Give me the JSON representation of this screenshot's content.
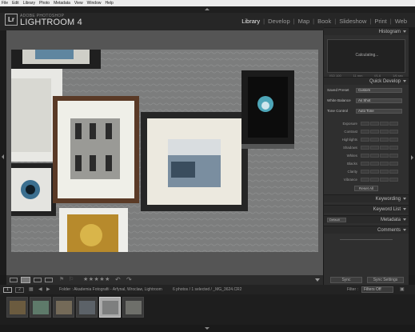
{
  "menubar": [
    "File",
    "Edit",
    "Library",
    "Photo",
    "Metadata",
    "View",
    "Window",
    "Help"
  ],
  "brand": {
    "logo": "Lr",
    "small": "ADOBE PHOTOSHOP",
    "big": "LIGHTROOM 4"
  },
  "modules": [
    {
      "label": "Library",
      "active": true
    },
    {
      "label": "Develop",
      "active": false
    },
    {
      "label": "Map",
      "active": false
    },
    {
      "label": "Book",
      "active": false
    },
    {
      "label": "Slideshow",
      "active": false
    },
    {
      "label": "Print",
      "active": false
    },
    {
      "label": "Web",
      "active": false
    }
  ],
  "right_panel": {
    "histogram_title": "Histogram",
    "histogram_status": "Calculating...",
    "histogram_stats": [
      "ISO 100",
      "11 mm",
      "f/1.6",
      "1/6 sec"
    ],
    "quick_develop_title": "Quick Develop",
    "saved_preset_label": "Saved Preset",
    "saved_preset_value": "Custom",
    "white_balance_label": "White Balance",
    "white_balance_value": "As Shot",
    "tone_control_label": "Tone Control",
    "auto_tone_label": "Auto Tone",
    "tone_rows": [
      "Exposure",
      "Contrast",
      "Highlights",
      "Shadows",
      "Whites",
      "Blacks",
      "Clarity",
      "Vibrance"
    ],
    "reset_label": "Reset All",
    "keywording_title": "Keywording",
    "keyword_list_title": "Keyword List",
    "metadata_title": "Metadata",
    "metadata_preset": "Default",
    "comments_title": "Comments"
  },
  "toolbar": {
    "sync_label": "Sync",
    "sync_settings_label": "Sync Settings",
    "stars": "★★★★★"
  },
  "filmstrip": {
    "pages": [
      "1",
      "2"
    ],
    "path": "Folder : Akademia Fotografii - Arfynal, Wroclaw, Lightroom",
    "selection": "6 photos / 1 selected / _MG_3624.CR2",
    "filter_label": "Filter :",
    "filter_value": "Filters Off"
  },
  "colors": {
    "accent_active": "#eeeeee",
    "panel_bg": "#2f2f2f",
    "selected_thumb": "#a9a9a9"
  }
}
